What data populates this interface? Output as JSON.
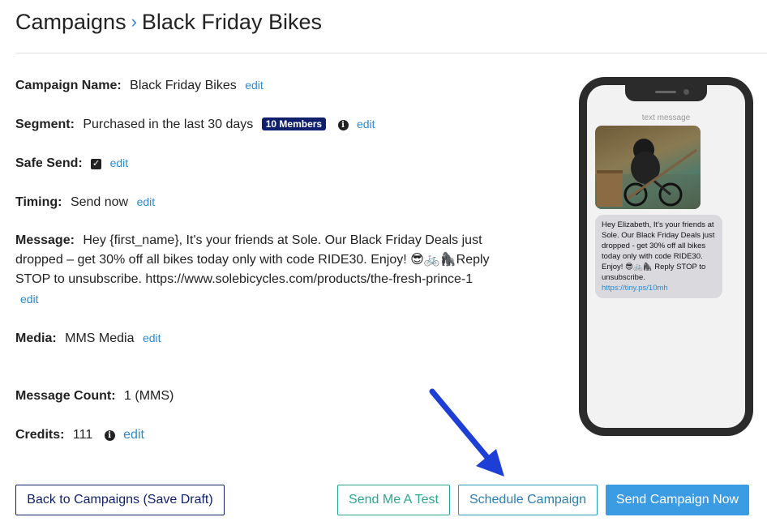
{
  "breadcrumb": {
    "root": "Campaigns",
    "separator": "›",
    "current": "Black Friday Bikes"
  },
  "fields": {
    "campaign_name": {
      "label": "Campaign Name:",
      "value": "Black Friday Bikes",
      "edit": "edit"
    },
    "segment": {
      "label": "Segment:",
      "value": "Purchased in the last 30 days",
      "badge": "10 Members",
      "edit": "edit"
    },
    "safe_send": {
      "label": "Safe Send:",
      "checked": true,
      "edit": "edit"
    },
    "timing": {
      "label": "Timing:",
      "value": "Send now",
      "edit": "edit"
    },
    "message": {
      "label": "Message:",
      "value": "Hey {first_name}, It's your friends at Sole. Our Black Friday Deals just dropped – get 30% off all bikes today only with code RIDE30. Enjoy! 😎🚲🦍Reply STOP to unsubscribe. https://www.solebicycles.com/products/the-fresh-prince-1",
      "edit": "edit"
    },
    "media": {
      "label": "Media:",
      "value": "MMS Media",
      "edit": "edit"
    },
    "message_count": {
      "label": "Message Count:",
      "value": "1 (MMS)"
    },
    "credits": {
      "label": "Credits:",
      "value": "111",
      "edit": "edit"
    }
  },
  "buttons": {
    "back": "Back to Campaigns (Save Draft)",
    "test": "Send Me A Test",
    "schedule": "Schedule Campaign",
    "send": "Send Campaign Now"
  },
  "preview": {
    "label": "text message",
    "bubble_text": "Hey Elizabeth, It's your friends at Sole. Our Black Friday Deals just dropped - get 30% off all bikes today only with code RIDE30. Enjoy! 😎🚲🦍 Reply STOP to unsubscribe.",
    "bubble_link": "https://tiny.ps/10mh"
  },
  "colors": {
    "accent": "#2a8bd3",
    "badge": "#0f1f6b",
    "send_button": "#3b9be3",
    "test_button": "#2aa78e",
    "arrow": "#1d3fd6"
  }
}
